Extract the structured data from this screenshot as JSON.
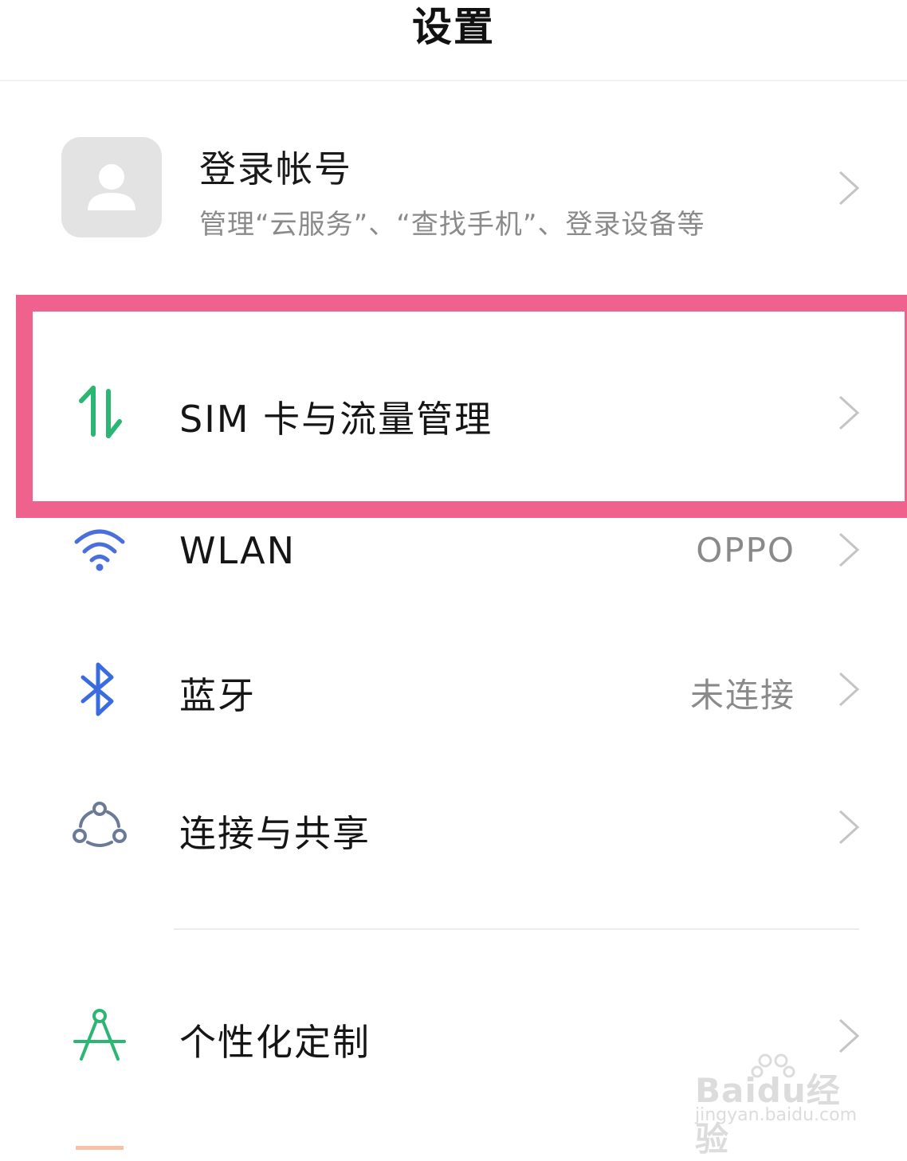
{
  "header": {
    "title": "设置"
  },
  "account": {
    "title": "登录帐号",
    "subtitle": "管理“云服务”、“查找手机”、登录设备等",
    "icon": "avatar-placeholder-icon"
  },
  "settings": {
    "items": [
      {
        "label": "SIM 卡与流量管理",
        "value": "",
        "icon": "data-transfer-icon",
        "icon_color": "#2bb673",
        "highlighted": true
      },
      {
        "label": "WLAN",
        "value": "OPPO",
        "icon": "wifi-icon",
        "icon_color": "#4a6fdc"
      },
      {
        "label": "蓝牙",
        "value": "未连接",
        "icon": "bluetooth-icon",
        "icon_color": "#3a6be0"
      },
      {
        "label": "连接与共享",
        "value": "",
        "icon": "share-nodes-icon",
        "icon_color": "#6b7a96"
      },
      {
        "label": "个性化定制",
        "value": "",
        "icon": "compass-icon",
        "icon_color": "#2bb673"
      }
    ]
  },
  "annotation": {
    "highlight_color": "#f0628e"
  },
  "watermark": {
    "main": "Baidu经验",
    "sub": "jingyan.baidu.com"
  }
}
